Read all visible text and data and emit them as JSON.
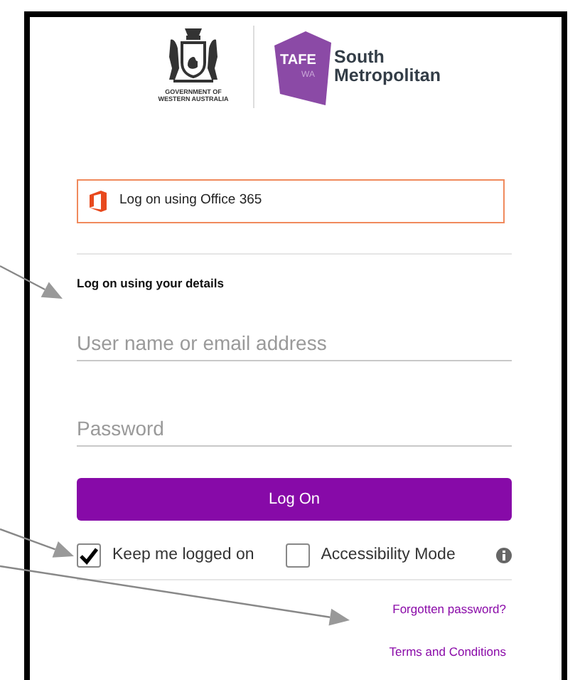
{
  "header": {
    "crest_caption": [
      "GOVERNMENT OF",
      "WESTERN AUSTRALIA"
    ],
    "tafe_mark": "TAFE",
    "tafe_sub": "WA",
    "institute": [
      "South",
      "Metropolitan"
    ]
  },
  "office_button": {
    "label": "Log on using Office 365"
  },
  "form": {
    "heading": "Log on using your details",
    "fields": [
      {
        "placeholder": "User name or email address"
      },
      {
        "placeholder": "Password"
      }
    ],
    "submit": "Log On",
    "options": [
      {
        "label": "Keep me logged on",
        "checked": true
      },
      {
        "label": "Accessibility Mode",
        "checked": false,
        "info": true
      }
    ]
  },
  "links": [
    "Forgotten password?",
    "Terms and Conditions"
  ]
}
